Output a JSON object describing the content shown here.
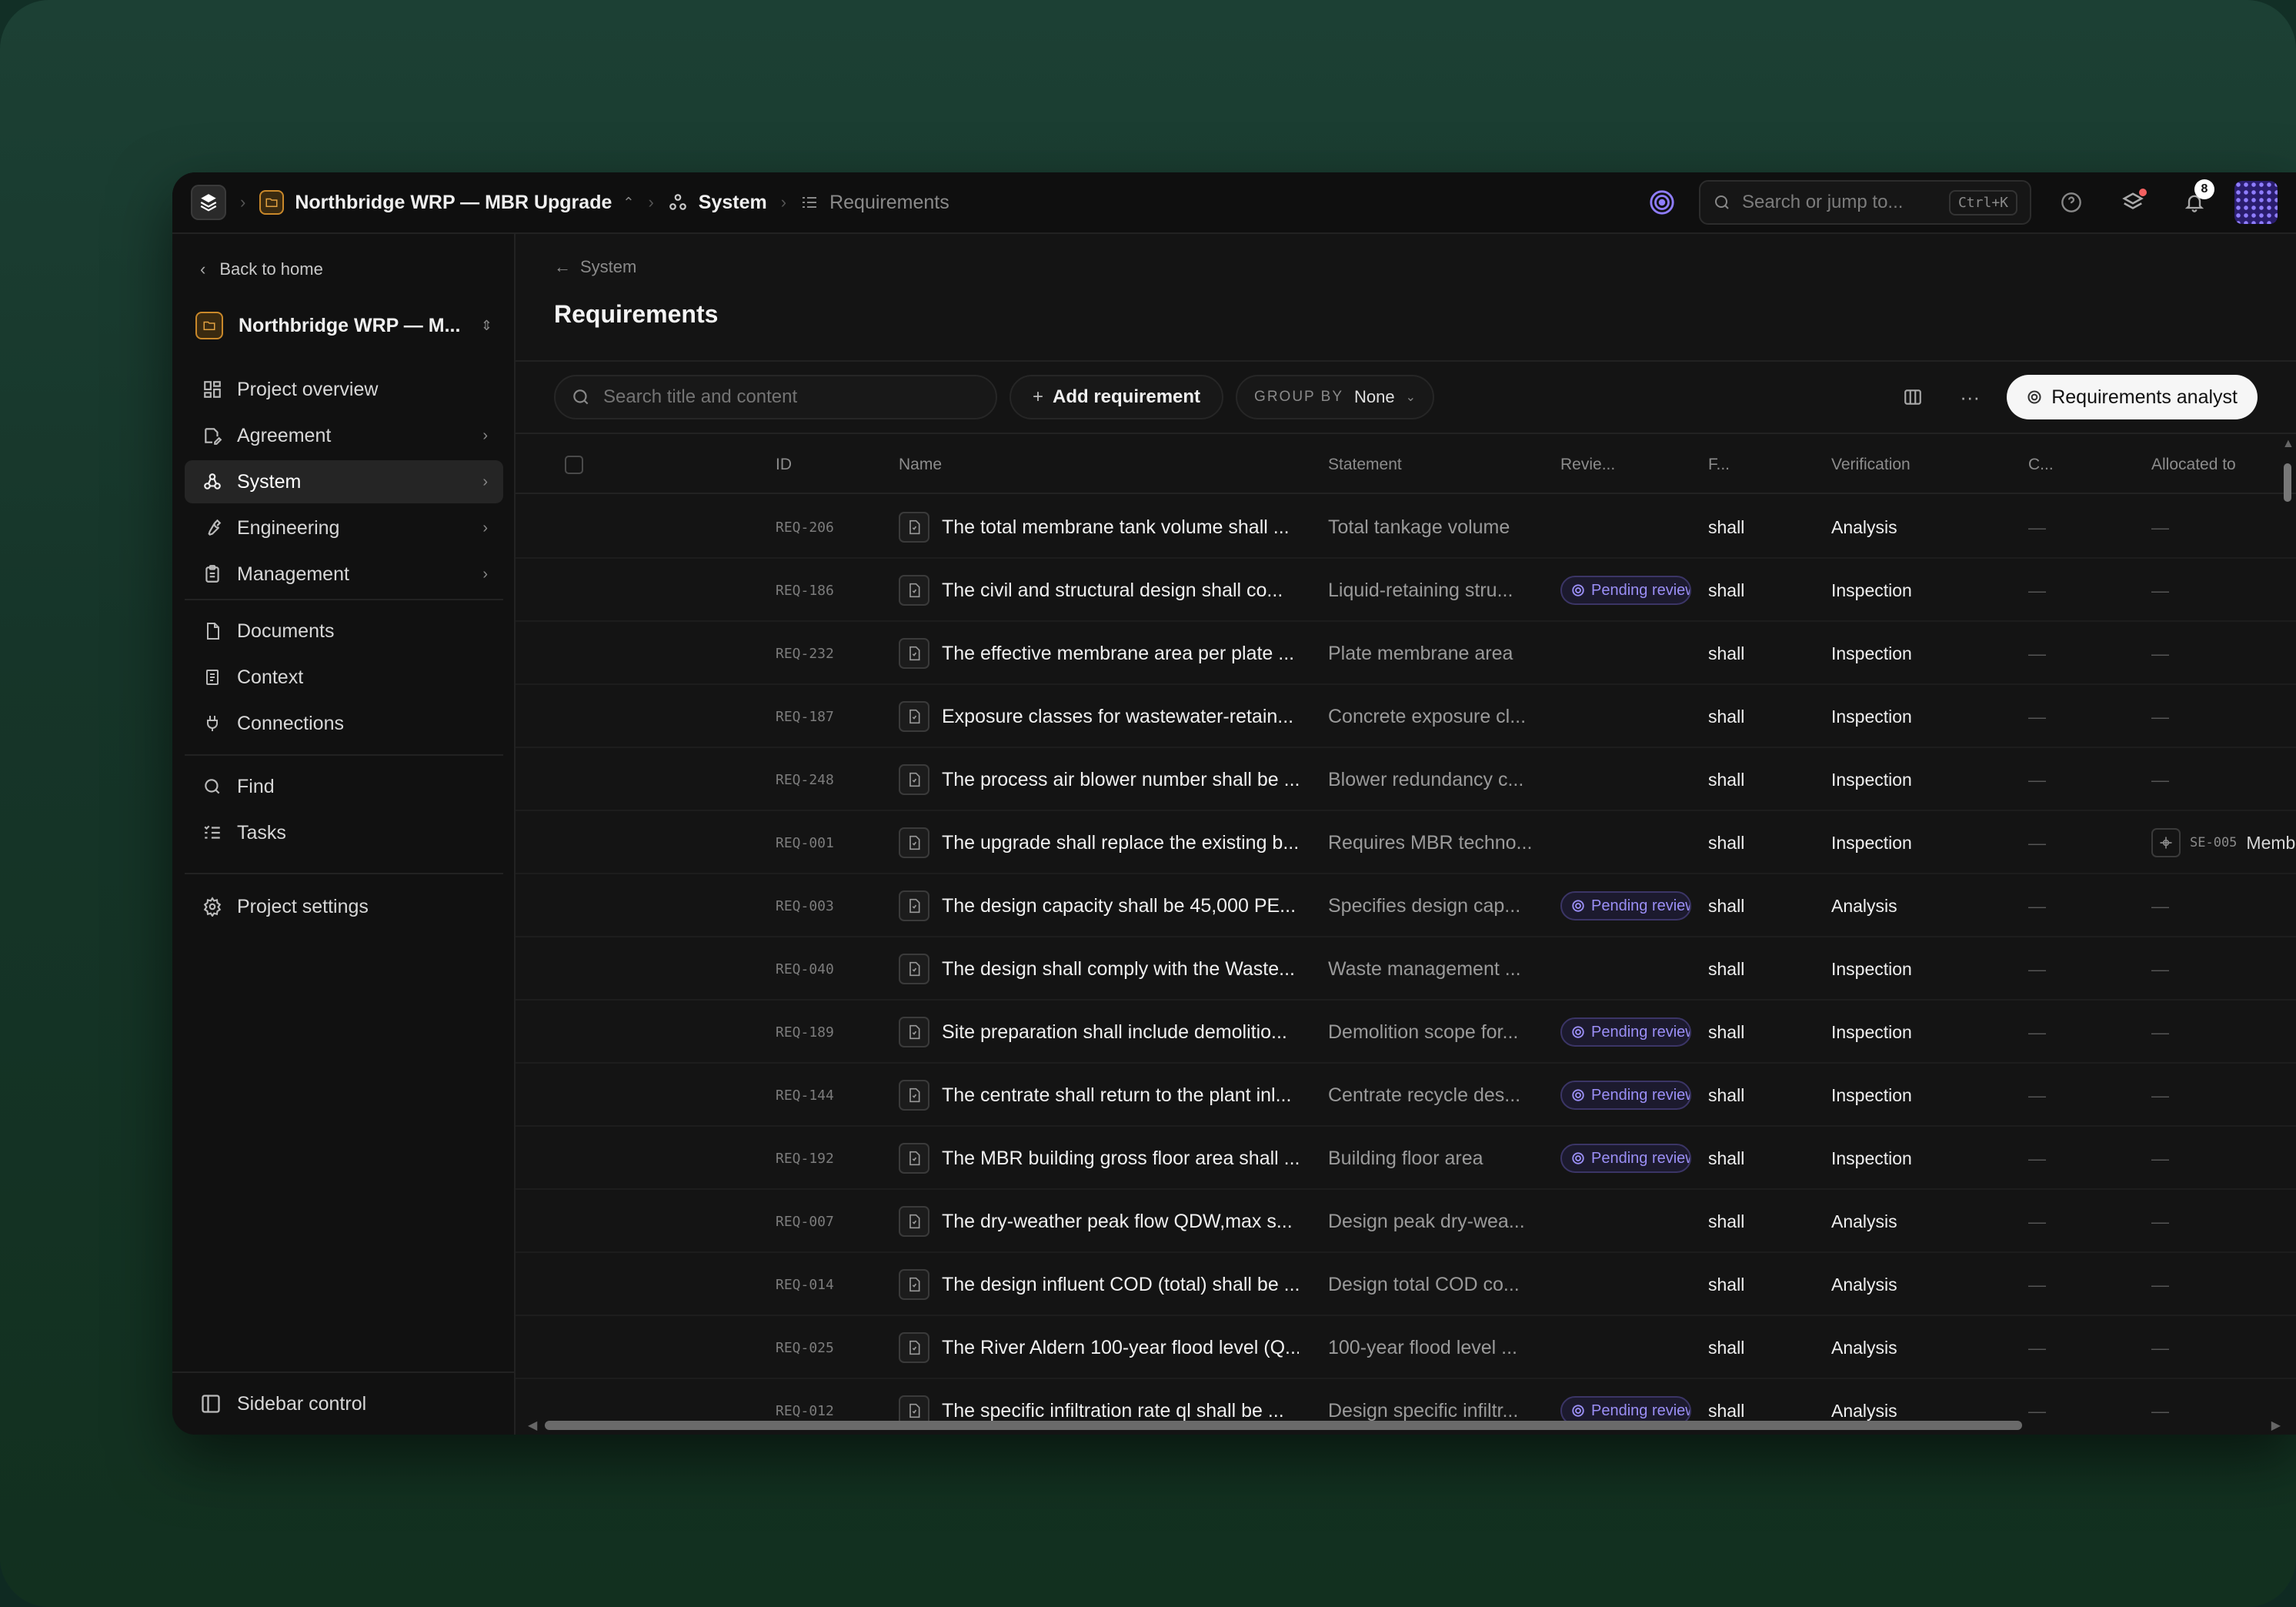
{
  "topbar": {
    "project": "Northbridge WRP — MBR Upgrade",
    "section": "System",
    "page": "Requirements",
    "search_placeholder": "Search or jump to...",
    "shortcut": "Ctrl+K",
    "notification_count": "8"
  },
  "sidebar": {
    "back_label": "Back to home",
    "project_name": "Northbridge WRP — M...",
    "nav": [
      {
        "label": "Project overview",
        "icon": "layout-grid-icon",
        "chevron": false,
        "active": false
      },
      {
        "label": "Agreement",
        "icon": "file-pen-icon",
        "chevron": true,
        "active": false
      },
      {
        "label": "System",
        "icon": "network-icon",
        "chevron": true,
        "active": true
      },
      {
        "label": "Engineering",
        "icon": "wrench-icon",
        "chevron": true,
        "active": false
      },
      {
        "label": "Management",
        "icon": "clipboard-icon",
        "chevron": true,
        "active": false
      }
    ],
    "nav2": [
      {
        "label": "Documents",
        "icon": "document-icon"
      },
      {
        "label": "Context",
        "icon": "context-icon"
      },
      {
        "label": "Connections",
        "icon": "plug-icon"
      }
    ],
    "nav3": [
      {
        "label": "Find",
        "icon": "search-icon"
      },
      {
        "label": "Tasks",
        "icon": "tasks-icon"
      }
    ],
    "settings_label": "Project settings",
    "sidebar_control_label": "Sidebar control"
  },
  "main": {
    "back_label": "System",
    "title": "Requirements",
    "search_placeholder": "Search title and content",
    "add_label": "Add requirement",
    "group_by_key": "GROUP BY",
    "group_by_value": "None",
    "analyst_label": "Requirements analyst"
  },
  "table": {
    "columns": {
      "id": "ID",
      "name": "Name",
      "statement": "Statement",
      "review": "Revie...",
      "f": "F...",
      "verification": "Verification",
      "c": "C...",
      "allocated": "Allocated to"
    },
    "rows": [
      {
        "id": "REQ-206",
        "name": "The total membrane tank volume shall ...",
        "statement": "Total tankage volume",
        "review": "",
        "f": "shall",
        "verification": "Analysis",
        "c": "—",
        "alloc": "—"
      },
      {
        "id": "REQ-186",
        "name": "The civil and structural design shall co...",
        "statement": "Liquid-retaining stru...",
        "review": "Pending review",
        "f": "shall",
        "verification": "Inspection",
        "c": "—",
        "alloc": "—"
      },
      {
        "id": "REQ-232",
        "name": "The effective membrane area per plate ...",
        "statement": "Plate membrane area",
        "review": "",
        "f": "shall",
        "verification": "Inspection",
        "c": "—",
        "alloc": "—"
      },
      {
        "id": "REQ-187",
        "name": "Exposure classes for wastewater-retain...",
        "statement": "Concrete exposure cl...",
        "review": "",
        "f": "shall",
        "verification": "Inspection",
        "c": "—",
        "alloc": "—"
      },
      {
        "id": "REQ-248",
        "name": "The process air blower number shall be ...",
        "statement": "Blower redundancy c...",
        "review": "",
        "f": "shall",
        "verification": "Inspection",
        "c": "—",
        "alloc": "—"
      },
      {
        "id": "REQ-001",
        "name": "The upgrade shall replace the existing b...",
        "statement": "Requires MBR techno...",
        "review": "",
        "f": "shall",
        "verification": "Inspection",
        "c": "—",
        "alloc": "",
        "alloc_code": "SE-005",
        "alloc_name": "Membrane filtr..."
      },
      {
        "id": "REQ-003",
        "name": "The design capacity shall be 45,000 PE...",
        "statement": "Specifies design cap...",
        "review": "Pending review",
        "f": "shall",
        "verification": "Analysis",
        "c": "—",
        "alloc": "—"
      },
      {
        "id": "REQ-040",
        "name": "The design shall comply with the Waste...",
        "statement": "Waste management ...",
        "review": "",
        "f": "shall",
        "verification": "Inspection",
        "c": "—",
        "alloc": "—"
      },
      {
        "id": "REQ-189",
        "name": "Site preparation shall include demolitio...",
        "statement": "Demolition scope for...",
        "review": "Pending review",
        "f": "shall",
        "verification": "Inspection",
        "c": "—",
        "alloc": "—"
      },
      {
        "id": "REQ-144",
        "name": "The centrate shall return to the plant inl...",
        "statement": "Centrate recycle des...",
        "review": "Pending review",
        "f": "shall",
        "verification": "Inspection",
        "c": "—",
        "alloc": "—"
      },
      {
        "id": "REQ-192",
        "name": "The MBR building gross floor area shall ...",
        "statement": "Building floor area",
        "review": "Pending review",
        "f": "shall",
        "verification": "Inspection",
        "c": "—",
        "alloc": "—"
      },
      {
        "id": "REQ-007",
        "name": "The dry-weather peak flow QDW,max s...",
        "statement": "Design peak dry-wea...",
        "review": "",
        "f": "shall",
        "verification": "Analysis",
        "c": "—",
        "alloc": "—"
      },
      {
        "id": "REQ-014",
        "name": "The design influent COD (total) shall be ...",
        "statement": "Design total COD co...",
        "review": "",
        "f": "shall",
        "verification": "Analysis",
        "c": "—",
        "alloc": "—"
      },
      {
        "id": "REQ-025",
        "name": "The River Aldern 100-year flood level (Q...",
        "statement": "100-year flood level ...",
        "review": "",
        "f": "shall",
        "verification": "Analysis",
        "c": "—",
        "alloc": "—"
      },
      {
        "id": "REQ-012",
        "name": "The specific infiltration rate ql shall be ...",
        "statement": "Design specific infiltr...",
        "review": "Pending review",
        "f": "shall",
        "verification": "Analysis",
        "c": "—",
        "alloc": "—"
      }
    ]
  }
}
